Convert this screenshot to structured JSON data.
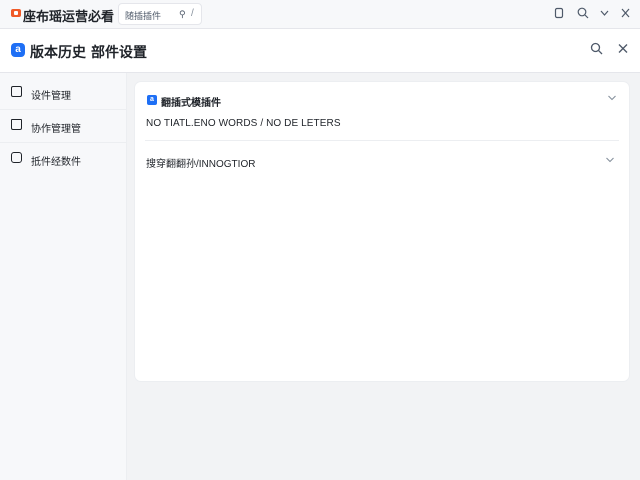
{
  "app": {
    "name": "座布瑶运营必看"
  },
  "tab": {
    "label": "随插插件",
    "pin_icon": "pin-icon",
    "sep": "/"
  },
  "window_icons": [
    "copy-icon",
    "search-icon",
    "chevron-down-icon",
    "close-icon"
  ],
  "header": {
    "logo_glyph": "a",
    "title": "版本历史",
    "subtitle": "部件设置",
    "search_icon": "search-icon",
    "close_icon": "close-icon"
  },
  "sidebar": {
    "items": [
      {
        "label": "设件管理",
        "icon": "edit-doc-icon"
      },
      {
        "label": "协作管理管",
        "icon": "home-icon"
      },
      {
        "label": "抵件经数件",
        "icon": "list-icon"
      }
    ]
  },
  "main": {
    "section1": {
      "icon_glyph": "a",
      "title": "翻插式模插件",
      "note": "NO TIATL.ENO WORDS / NO DE LETERS"
    },
    "section2": {
      "label": "搜穿翻翻孙/INNOGTIOR"
    }
  },
  "colors": {
    "accent": "#1e6ff5",
    "brand": "#f05a28",
    "background": "#f2f3f5"
  }
}
